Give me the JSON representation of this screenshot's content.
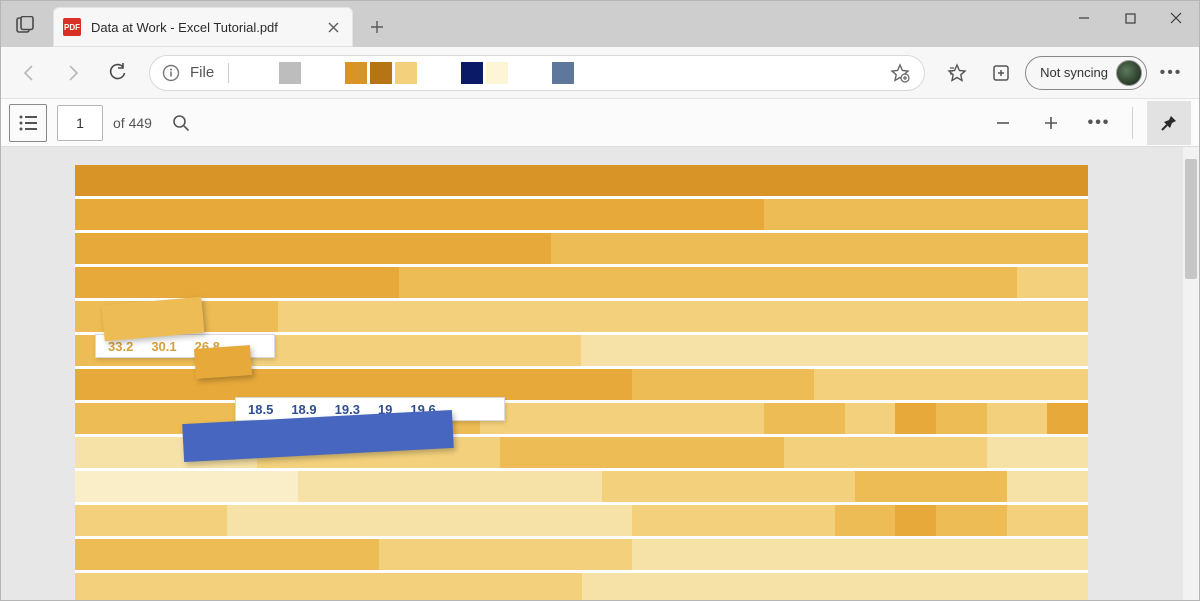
{
  "tab": {
    "title": "Data at Work - Excel Tutorial.pdf",
    "favicon_label": "PDF"
  },
  "addressbar": {
    "label": "File"
  },
  "swatches": {
    "grey": "#bdbdbd",
    "group_a": [
      "#d99427",
      "#b77414",
      "#f3d17c"
    ],
    "group_b": [
      "#0a1a66",
      "#fdf6d6"
    ],
    "group_c": [
      "#5e779b"
    ]
  },
  "profile": {
    "label": "Not syncing"
  },
  "pdf": {
    "page": "1",
    "of_label": "of 449"
  },
  "cover": {
    "data_row_1": [
      "33.2",
      "30.1",
      "26.8"
    ],
    "data_row_2": [
      "18.5",
      "18.9",
      "19.3",
      "19",
      "19.6"
    ]
  }
}
